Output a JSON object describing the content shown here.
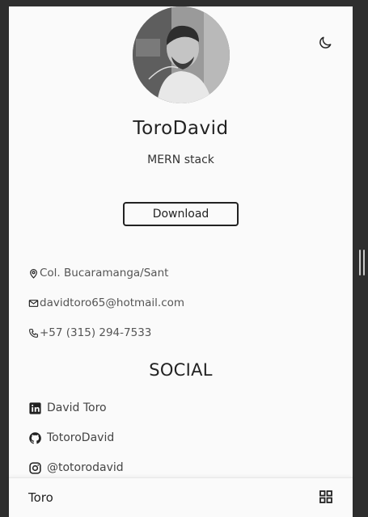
{
  "profile": {
    "name": "ToroDavid",
    "role": "MERN stack",
    "download_label": "Download"
  },
  "contact": {
    "location": "Col. Bucaramanga/Sant",
    "email": "davidtoro65@hotmail.com",
    "phone": "+57 (315) 294-7533"
  },
  "social": {
    "title": "SOCIAL",
    "linkedin": "David Toro",
    "github": "TotoroDavid",
    "instagram": "@totorodavid"
  },
  "nav": {
    "logo": "Toro"
  },
  "icons": {
    "theme": "moon-icon",
    "location": "map-pin-icon",
    "email": "mail-icon",
    "phone": "phone-icon",
    "linkedin": "linkedin-icon",
    "github": "github-icon",
    "instagram": "instagram-icon",
    "menu": "grid-menu-icon"
  },
  "colors": {
    "background": "#fafafa",
    "frame": "#2e2e2e",
    "text": "#222222",
    "muted": "#555555"
  }
}
